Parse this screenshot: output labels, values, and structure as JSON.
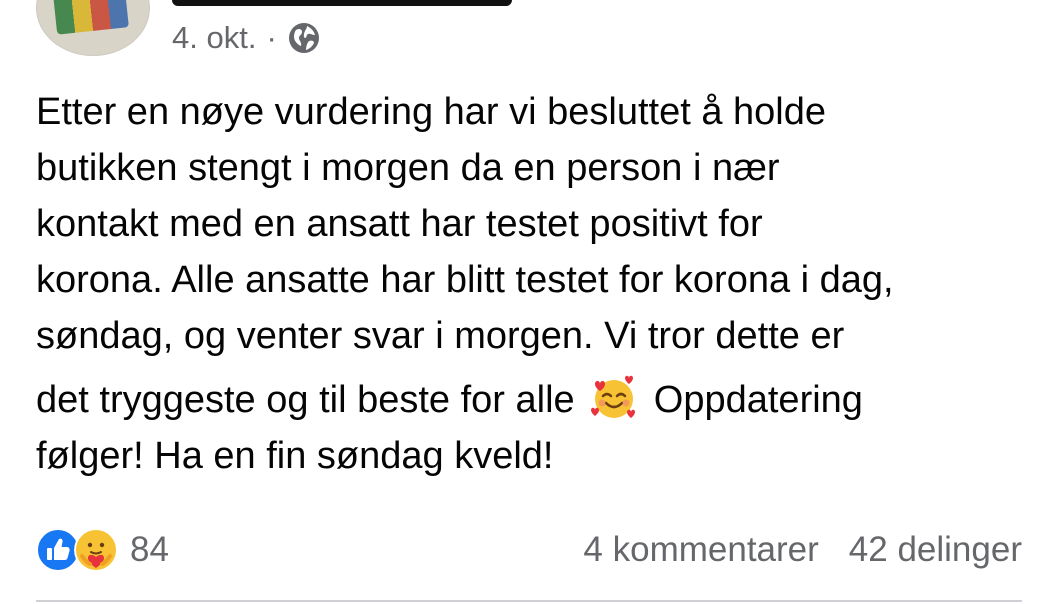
{
  "post": {
    "date": "4. okt.",
    "separator": "·",
    "lines": [
      "Etter en nøye vurdering har vi besluttet å holde",
      "butikken stengt i morgen da en person i nær",
      "kontakt med en ansatt har testet positivt for",
      "korona. Alle ansatte har blitt testet for korona i dag,",
      "søndag, og venter svar i morgen. Vi tror dette er"
    ],
    "line6_before": "det tryggeste og til beste for alle",
    "line6_after": "Oppdatering",
    "line7": "følger! Ha en fin søndag kveld!",
    "emoji": "smiling-face-with-hearts"
  },
  "footer": {
    "reaction_count": "84",
    "comments": "4 kommentarer",
    "shares": "42 delinger"
  },
  "colors": {
    "text": "#050505",
    "meta": "#65676b",
    "like_blue": "#1877f2",
    "divider": "#ced0d4"
  }
}
